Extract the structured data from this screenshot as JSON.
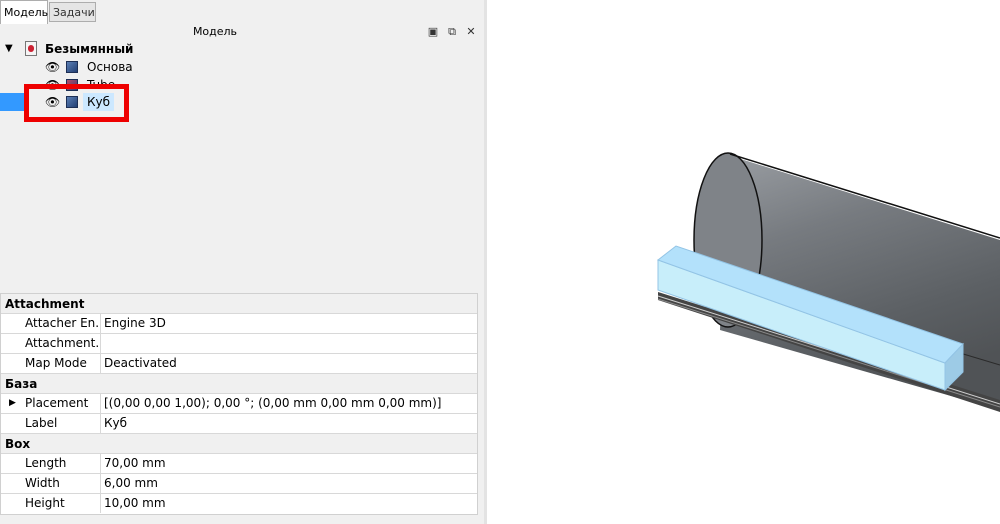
{
  "tabs": {
    "model": "Модель",
    "tasks": "Задачи"
  },
  "tree_panel": {
    "title": "Модель",
    "document": "Безымянный",
    "items": [
      {
        "label": "Основа",
        "icon": "part-icon"
      },
      {
        "label": "Tube",
        "icon": "tube-icon"
      },
      {
        "label": "Куб",
        "icon": "cube-icon",
        "selected": true
      }
    ]
  },
  "properties": {
    "groups": [
      {
        "name": "Attachment",
        "rows": [
          {
            "name": "Attacher En...",
            "value": "Engine 3D"
          },
          {
            "name": "Attachment...",
            "value": ""
          },
          {
            "name": "Map Mode",
            "value": "Deactivated"
          }
        ]
      },
      {
        "name": "База",
        "rows": [
          {
            "name": "Placement",
            "value": "[(0,00 0,00 1,00); 0,00 °; (0,00 mm  0,00 mm  0,00 mm)]"
          },
          {
            "name": "Label",
            "value": "Куб"
          }
        ]
      },
      {
        "name": "Box",
        "rows": [
          {
            "name": "Length",
            "value": "70,00 mm"
          },
          {
            "name": "Width",
            "value": "6,00 mm"
          },
          {
            "name": "Height",
            "value": "10,00 mm"
          }
        ]
      }
    ]
  },
  "colors": {
    "selection": "#3399ff",
    "highlight_box": "#ee0000",
    "cube_fill": "#c8eefa"
  }
}
